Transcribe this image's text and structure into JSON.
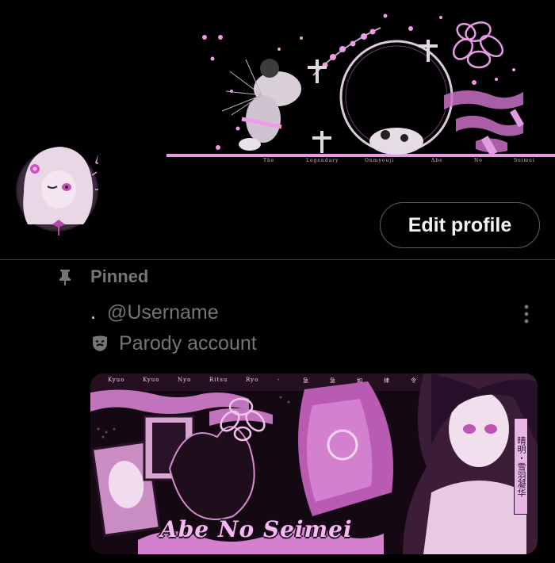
{
  "banner": {
    "caption_words": [
      "The",
      "Legendary",
      "Onmyouji",
      "Abe",
      "No",
      "Seimei"
    ],
    "accent": "#e59be2"
  },
  "profile": {
    "edit_button_label": "Edit profile"
  },
  "pinned": {
    "label": "Pinned",
    "handle_prefix": ".",
    "handle": "@Username",
    "parody_label": "Parody account"
  },
  "media": {
    "topline": [
      "Kyuo",
      "Kyuo",
      "Nyo",
      "Ritsu",
      "Ryo",
      "-",
      "急",
      "急",
      "如",
      "律",
      "令"
    ],
    "title": "Abe No Seimei",
    "vertical_text": "晴明・雪羽凝华"
  },
  "colors": {
    "background": "#000000",
    "muted_text": "#71767b",
    "border": "#536471",
    "pink": "#e59be2"
  },
  "icons": {
    "pin": "pin-icon",
    "more": "more-vertical-icon",
    "mask": "theater-mask-icon"
  }
}
